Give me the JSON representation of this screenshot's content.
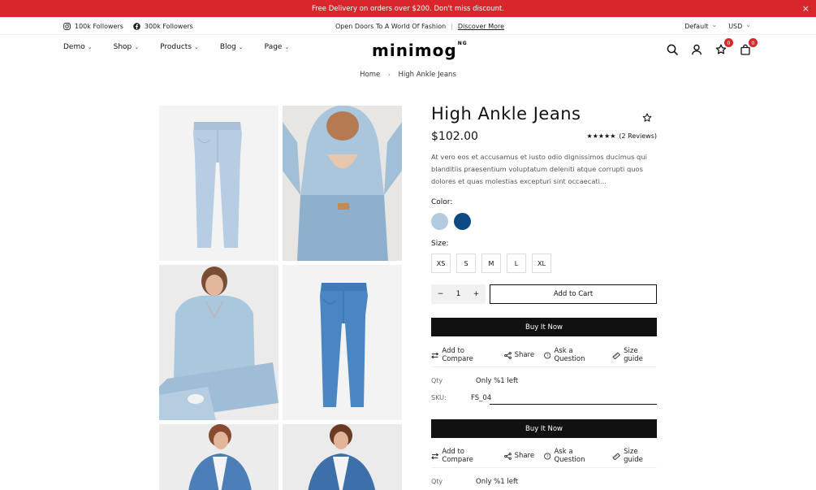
{
  "announcement": {
    "text": "Free Delivery on orders over $200. Don't miss discount.",
    "close": "×"
  },
  "topbar": {
    "instagram": "100k Followers",
    "facebook": "300k Followers",
    "promo": "Open Doors To A World Of Fashion",
    "promo_sep": "|",
    "promo_link": "Discover More",
    "language": "Default",
    "currency": "USD"
  },
  "nav": {
    "items": [
      "Demo",
      "Shop",
      "Products",
      "Blog",
      "Page"
    ]
  },
  "logo": {
    "text": "minimog",
    "sup": "NG"
  },
  "header": {
    "wishlist_count": "0",
    "cart_count": "0"
  },
  "breadcrumb": {
    "home": "Home",
    "sep": "›",
    "current": "High Ankle Jeans"
  },
  "product": {
    "title": "High Ankle Jeans",
    "price": "$102.00",
    "stars": "★★★★★",
    "reviews": "(2 Reviews)",
    "description": "At vero eos et accusamus et iusto odio dignissimos ducimus qui blanditiis praesentium voluptatum deleniti atque corrupti quos dolores et quas molestias excepturi sint occaecati...",
    "color_label": "Color:",
    "colors": [
      "#b3cbdf",
      "#0e4a84"
    ],
    "size_label": "Size:",
    "sizes": [
      "XS",
      "S",
      "M",
      "L",
      "XL"
    ],
    "qty": "1",
    "qty_minus": "−",
    "qty_plus": "+",
    "add_to_cart": "Add to Cart",
    "buy_now": "Buy It Now",
    "actions": [
      "Add to Compare",
      "Share",
      "Ask a Question",
      "Size guide"
    ],
    "qty_label": "Qty",
    "stock": "Only %1 left",
    "sku_label": "SKU:",
    "sku": "FS_04"
  }
}
